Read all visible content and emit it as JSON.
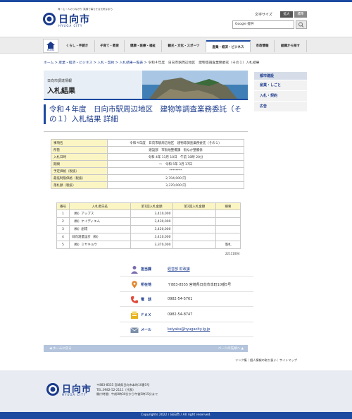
{
  "header": {
    "tagline": "海・山・人のつながり 笑顔で暮らせる元気なまち",
    "site_name": "日向市",
    "site_name_en": "HYUGA CITY",
    "font_size_label": "文字サイズ",
    "font_large": "拡大",
    "font_standard": "標準",
    "search_placeholder": "Google 提供"
  },
  "nav": {
    "home": "HOME",
    "items": [
      "くらし・手続き",
      "子育て・教育",
      "健康・医療・福祉",
      "観光・文化・スポーツ",
      "産業・経済・ビジネス",
      "市政情報",
      "組織から探す"
    ]
  },
  "breadcrumb": [
    "ホーム",
    "産業・経済・ビジネス",
    "入札・契約",
    "入札結果一覧表",
    "令和４年度　日向市駅周辺地区　建物等調査業務委託（その１）入札結果"
  ],
  "banner": {
    "subtitle": "日向市調達情報",
    "title": "入札結果"
  },
  "side_menu": {
    "head": "都市建設",
    "items": [
      "産業・しごと",
      "入札・契約",
      "広告"
    ]
  },
  "page_title": "令和４年度　日向市駅周辺地区　建物等調査業務委託（その１）入札結果 詳細",
  "info": [
    {
      "k": "事項名",
      "v": "令和４年度　日向市駅周辺地区　建物等調査業務委託（その１）"
    },
    {
      "k": "所管",
      "v": "建設部　市街地整備課　街なか整備係"
    },
    {
      "k": "入札日時",
      "v": "令和 4年 11月 10日　午前 10時 20分"
    },
    {
      "k": "期間",
      "v": "～　令和 5年 3月 17日"
    },
    {
      "k": "予定価格（税抜）",
      "v": "********"
    },
    {
      "k": "最低制限価格（税抜）",
      "v": "2,704,000 円"
    },
    {
      "k": "落札額（税抜）",
      "v": "3,370,000 円"
    }
  ],
  "bids": {
    "headers": [
      "番号",
      "入札者氏名",
      "第1回入札金額",
      "第2回入札金額",
      "摘要"
    ],
    "rows": [
      {
        "no": "1",
        "name": "（株）アップス",
        "r1": "3,410,000",
        "r2": "",
        "note": ""
      },
      {
        "no": "2",
        "name": "（株）ケイディエム",
        "r1": "3,430,000",
        "r2": "",
        "note": ""
      },
      {
        "no": "3",
        "name": "（株）創環",
        "r1": "3,420,000",
        "r2": "",
        "note": ""
      },
      {
        "no": "4",
        "name": "日向測量設計（株）",
        "r1": "3,410,000",
        "r2": "",
        "note": ""
      },
      {
        "no": "5",
        "name": "（株）ミヤキョウ",
        "r1": "3,370,000",
        "r2": "",
        "note": "落札"
      }
    ],
    "code": "22111004"
  },
  "contact": {
    "dept_label": "担当課",
    "dept_value": "経営部 財政課",
    "loc_label": "所在地",
    "loc_value": "〒883-8555 宮崎県日向市本町10番5号",
    "tel_label": "電　話",
    "tel_value": "0982-54-5761",
    "fax_label": "ＦＡＸ",
    "fax_value": "0982-54-8747",
    "mail_label": "メール",
    "mail_value": "keiyaku@hyugacity.lg.jp"
  },
  "pagebar": {
    "home": "ホームに戻る",
    "top": "ページの先頭へ"
  },
  "footlinks": "リンク集｜個人情報の取り扱い｜サイトマップ",
  "footer": {
    "name": "日向市",
    "name_en": "HYUGA CITY",
    "addr1": "〒883-8555 宮崎県日向市本町10番5号",
    "addr2": "TEL.0982-52-2111（代表）",
    "addr3": "開庁時間：午前8時30分から午後5時15分まで",
    "copyright": "Copyrights 2022 / 日向市 / All right reserved."
  },
  "colors": {
    "brand": "#1c4aa0",
    "highlight": "#fbf5c4"
  }
}
